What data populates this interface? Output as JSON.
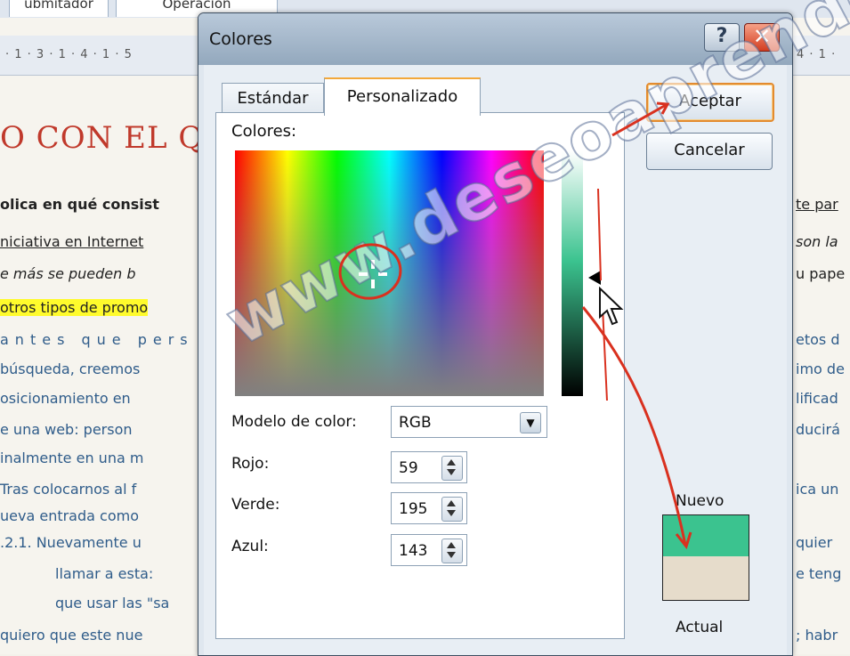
{
  "document": {
    "tabs": [
      "ubmitador",
      "Operacion"
    ],
    "ruler": "· 1 · 3 · 1 · 4 · 1 · 5",
    "ruler_right": "4 · 1 ·",
    "left_lines": [
      "O CON EL QU",
      "olica en qué consist",
      "niciativa en Internet",
      "e más se pueden b",
      "otros tipos de promo",
      "antes que pers",
      "búsqueda, creemos",
      "osicionamiento en",
      "e una web: person",
      "inalmente en una m",
      "Tras colocarnos al f",
      "ueva entrada como",
      ".2.1. Nuevamente u",
      "llamar a esta:",
      "que usar las \"sa",
      "quiero que este nue"
    ],
    "right_lines": [
      "te par",
      "son la",
      "u pape",
      "etos d",
      "imo de",
      "lificad",
      "ducirá",
      "ica un",
      "quier",
      "e teng",
      "; habr"
    ]
  },
  "dialog": {
    "title": "Colores",
    "help_label": "?",
    "close_label": "✕",
    "tabs": [
      "Estándar",
      "Personalizado"
    ],
    "colors_label": "Colores:",
    "color_model_label": "Modelo de color:",
    "color_model_value": "RGB",
    "red_label": "Rojo:",
    "red_value": "59",
    "green_label": "Verde:",
    "green_value": "195",
    "blue_label": "Azul:",
    "blue_value": "143",
    "ok_label": "Aceptar",
    "cancel_label": "Cancelar",
    "new_label": "Nuevo",
    "current_label": "Actual",
    "new_color": "#3bc38f",
    "current_color": "#e6dccb"
  },
  "watermark": "www.deseoaprender.com",
  "accent": {
    "annotation_red": "#d9311f",
    "tab_orange": "#f3a83a"
  }
}
